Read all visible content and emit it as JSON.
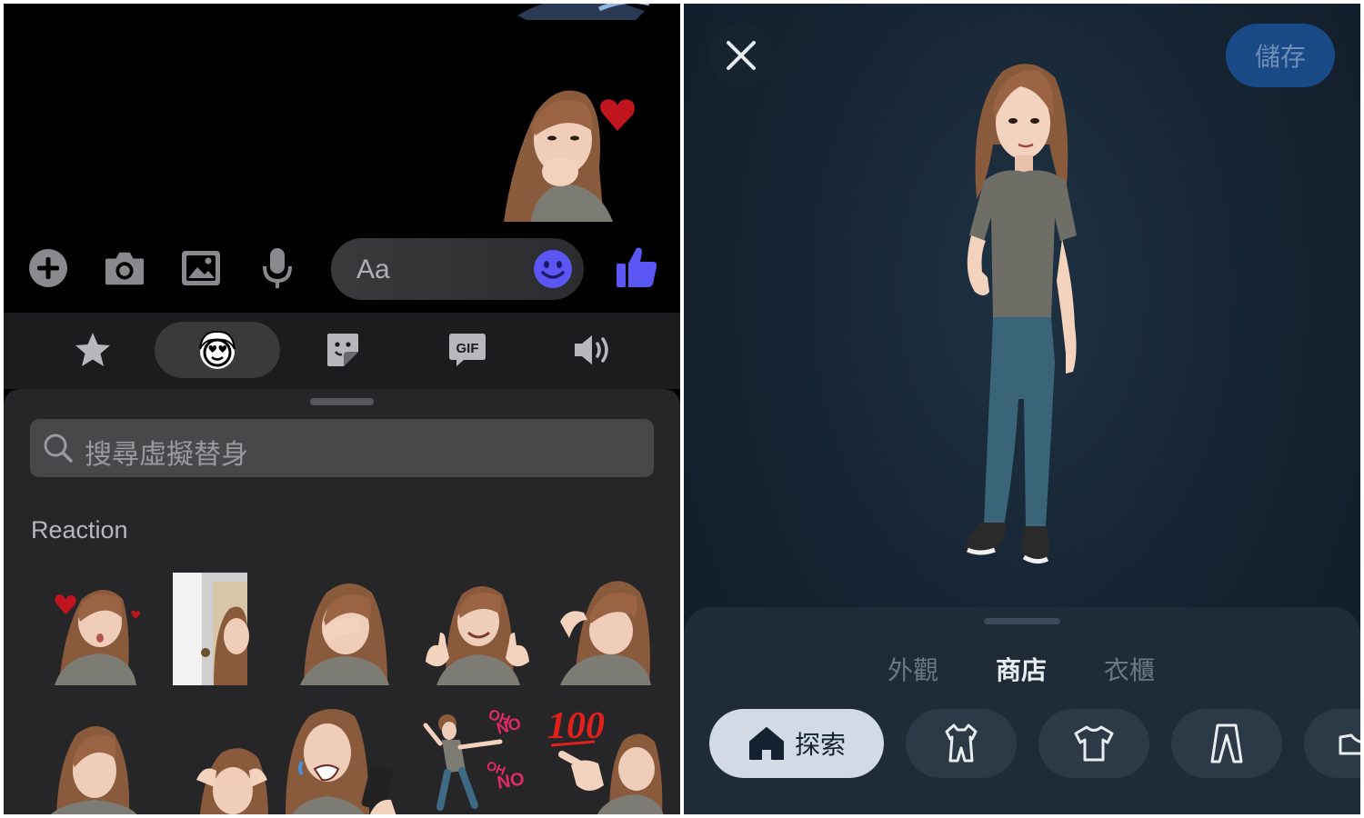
{
  "messenger": {
    "composer": {
      "placeholder": "Aa",
      "buttons": [
        "add-icon",
        "camera-icon",
        "image-icon",
        "microphone-icon"
      ],
      "emoji_icon": "smiley-icon",
      "like_icon": "thumbs-up-icon",
      "accent_color": "#5b57f5"
    },
    "tabs": [
      {
        "icon": "star-icon",
        "active": false
      },
      {
        "icon": "avatar-face-icon",
        "active": true
      },
      {
        "icon": "sticker-icon",
        "active": false
      },
      {
        "icon": "gif-icon",
        "label": "GIF",
        "active": false
      },
      {
        "icon": "sound-icon",
        "active": false
      }
    ],
    "search": {
      "placeholder": "搜尋虛擬替身"
    },
    "section_title": "Reaction",
    "sticker_overlay_text": {
      "oh_no": [
        "OH",
        "NO",
        "OH",
        "NO"
      ],
      "hundred": "100"
    }
  },
  "avatar_editor": {
    "save_label": "儲存",
    "segments": [
      {
        "label": "外觀",
        "active": false
      },
      {
        "label": "商店",
        "active": true
      },
      {
        "label": "衣櫃",
        "active": false
      }
    ],
    "categories": [
      {
        "icon": "home-icon",
        "label": "探索",
        "active": true
      },
      {
        "icon": "outfit-icon",
        "label": "",
        "active": false
      },
      {
        "icon": "tshirt-icon",
        "label": "",
        "active": false
      },
      {
        "icon": "pants-icon",
        "label": "",
        "active": false
      },
      {
        "icon": "shoe-icon",
        "label": "",
        "active": false
      }
    ]
  }
}
